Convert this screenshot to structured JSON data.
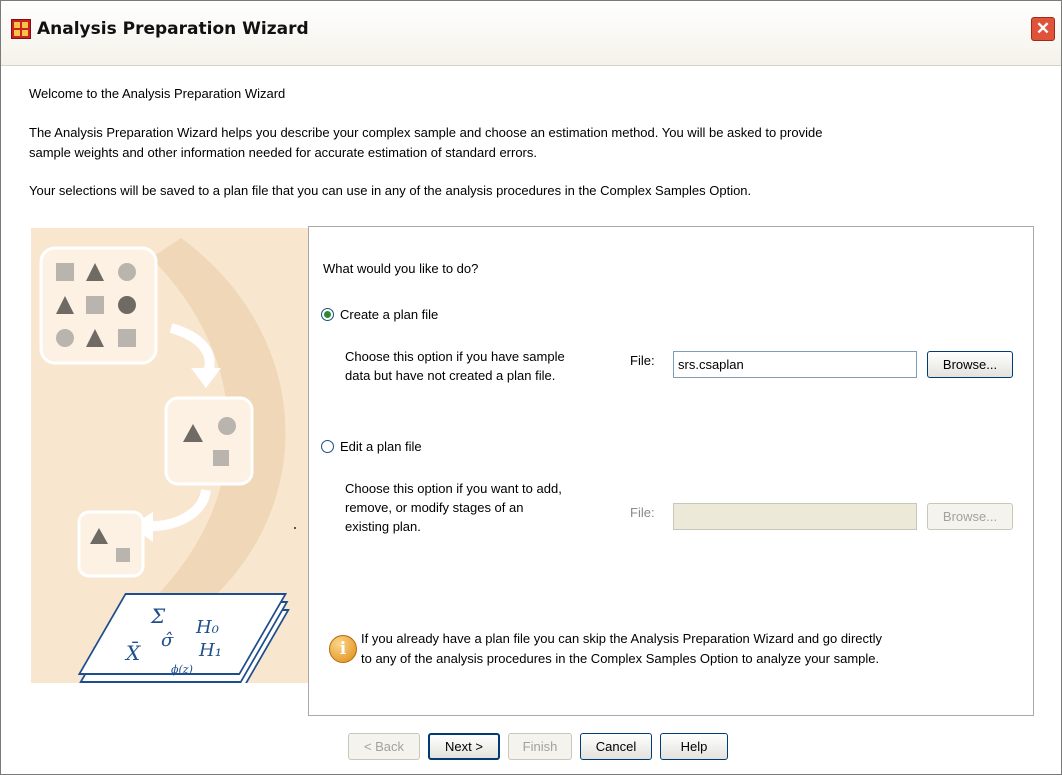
{
  "window": {
    "title": "Analysis Preparation Wizard",
    "close_glyph": "✕"
  },
  "intro": {
    "welcome": "Welcome to the Analysis Preparation Wizard",
    "para1_line1": "The Analysis Preparation Wizard helps you describe your complex sample and choose an estimation method. You will be asked to provide",
    "para1_line2": "sample weights and other information needed for accurate estimation of standard errors.",
    "para2": "Your selections will be saved to a plan file that you can use in any of the analysis procedures in the Complex Samples Option."
  },
  "options": {
    "prompt": "What would you like to do?",
    "create": {
      "label": "Create a plan file",
      "selected": true,
      "desc_line1": "Choose this option if you have sample",
      "desc_line2": "data but have not created a plan file.",
      "file_label": "File:",
      "file_value": "srs.csaplan",
      "browse_label": "Browse..."
    },
    "edit": {
      "label": "Edit a plan file",
      "selected": false,
      "desc_line1": "Choose this option if you want to add,",
      "desc_line2": "remove, or modify stages of an",
      "desc_line3": "existing plan.",
      "file_label": "File:",
      "file_value": "",
      "browse_label": "Browse..."
    },
    "info_line1": "If you already have a plan file you can skip the Analysis Preparation Wizard and go directly",
    "info_line2": "to any of the analysis procedures in the Complex Samples Option to analyze your sample."
  },
  "buttons": {
    "back": "< Back",
    "next": "Next >",
    "finish": "Finish",
    "cancel": "Cancel",
    "help": "Help"
  },
  "illustration": {
    "symbols": [
      "Σ",
      "H₀",
      "σ̂",
      "H₁",
      "X̄",
      "ϕ(z)"
    ]
  },
  "colors": {
    "accent": "#316ac5",
    "illustration_bg": "#f8e6cf",
    "illustration_card": "#fdf1e4",
    "shape_gray": "#b9b4ad"
  }
}
